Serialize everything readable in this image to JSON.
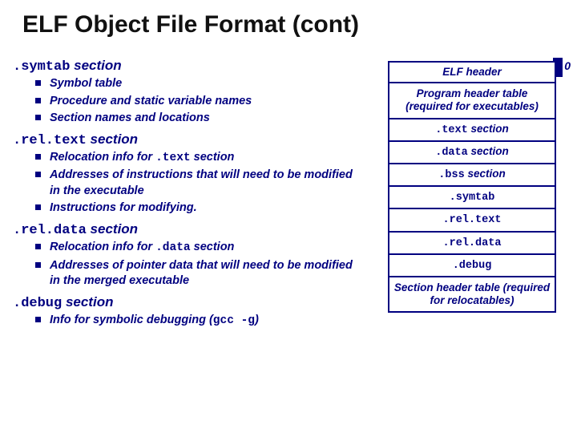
{
  "title": "ELF Object File Format (cont)",
  "offset_label": "0",
  "sections": {
    "symtab": {
      "head_code": ".symtab",
      "head_suffix": " section",
      "items": [
        "Symbol table",
        "Procedure and static variable names",
        "Section names and locations"
      ]
    },
    "reltext": {
      "head_code": ".rel.text",
      "head_suffix": " section",
      "items": [
        {
          "pre": "Relocation info for ",
          "code": ".text",
          "post": " section"
        },
        "Addresses of instructions that will need to be modified in the executable",
        "Instructions for modifying."
      ]
    },
    "reldata": {
      "head_code": ".rel.data",
      "head_suffix": " section",
      "items": [
        {
          "pre": "Relocation info for ",
          "code": ".data",
          "post": " section"
        },
        "Addresses of pointer data that will need to be modified in the merged executable"
      ]
    },
    "debug": {
      "head_code": ".debug",
      "head_suffix": " section",
      "items": [
        {
          "pre": "Info for symbolic debugging (",
          "code": "gcc -g",
          "post": ")"
        }
      ]
    }
  },
  "diagram": {
    "cells": [
      {
        "text": "ELF header"
      },
      {
        "text": "Program header table (required for executables)"
      },
      {
        "code": ".text",
        "suffix": " section"
      },
      {
        "code": ".data",
        "suffix": " section"
      },
      {
        "code": ".bss",
        "suffix": " section"
      },
      {
        "code": ".symtab"
      },
      {
        "code": ".rel.text"
      },
      {
        "code": ".rel.data"
      },
      {
        "code": ".debug"
      },
      {
        "text": "Section header table (required for relocatables)"
      }
    ]
  }
}
